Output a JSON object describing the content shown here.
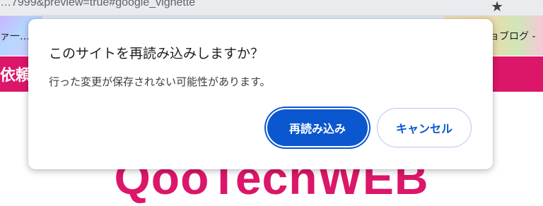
{
  "browser": {
    "url_fragment": "…7999&preview=true#google_vignette",
    "bookmark_left": "ァ一…",
    "bookmark_right": "ョブログ -"
  },
  "site": {
    "band_text": "依頼",
    "logo_text": "QooTechWEB",
    "brand_color": "#dc1669"
  },
  "dialog": {
    "title": "このサイトを再読み込みしますか？",
    "message": "行った変更が保存されない可能性があります。",
    "reload_label": "再読み込み",
    "cancel_label": "キャンセル",
    "accent_color": "#0b57d0"
  }
}
